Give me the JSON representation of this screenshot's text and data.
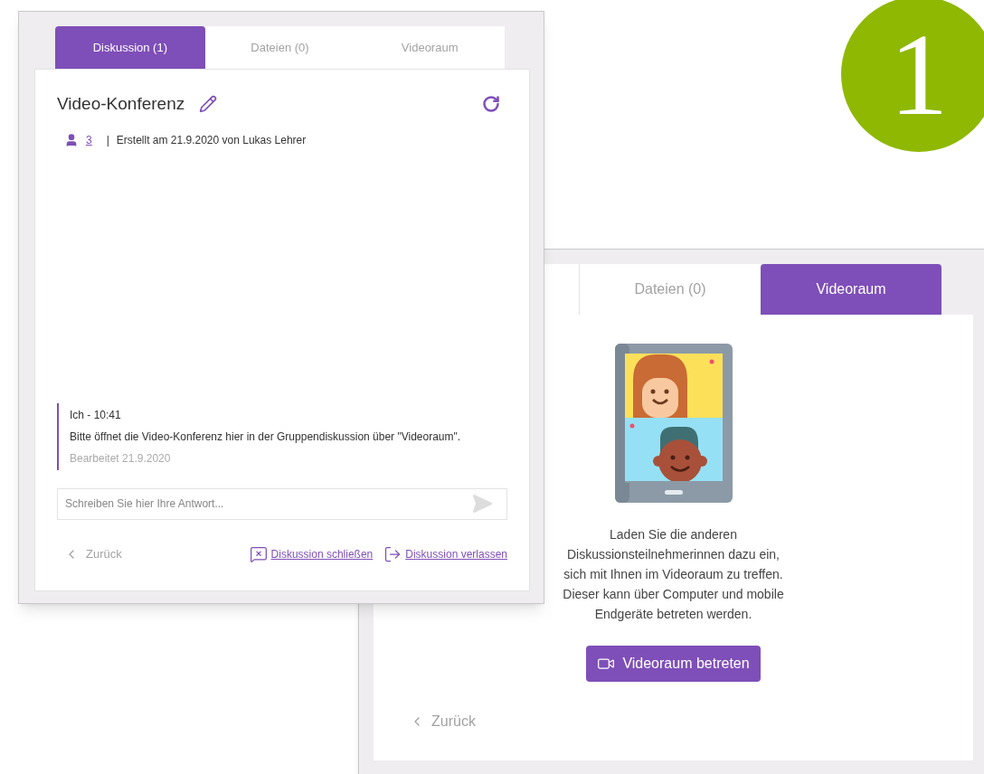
{
  "badge": "1",
  "discussion_window": {
    "tabs": [
      {
        "label": "Diskussion (1)",
        "selected": true
      },
      {
        "label": "Dateien (0)",
        "selected": false
      },
      {
        "label": "Videoraum",
        "selected": false
      }
    ],
    "title": "Video-Konferenz",
    "participants": "3",
    "separator": "|",
    "created": "Erstellt am 21.9.2020 von Lukas Lehrer",
    "message": {
      "header": "Ich - 10:41",
      "text": "Bitte öffnet die Video-Konferenz hier in der Gruppendiskussion über \"Videoraum\".",
      "edited": "Bearbeitet 21.9.2020"
    },
    "reply": {
      "placeholder": "Schreiben Sie hier Ihre Antwort..."
    },
    "back": "Zurück",
    "actions": [
      {
        "kind": "close",
        "label": "Diskussion schließen"
      },
      {
        "kind": "leave",
        "label": "Diskussion verlassen"
      }
    ]
  },
  "videoroom_window": {
    "tabs": [
      {
        "label": "Dateien (0)",
        "selected": false
      },
      {
        "label": "Videoraum",
        "selected": true
      }
    ],
    "text": "Laden Sie die anderen Diskussionsteilnehmerinnen dazu ein, sich mit Ihnen im Videoraum zu treffen. Dieser kann über Computer und mobile Endgeräte betreten werden.",
    "button": "Videoraum betreten",
    "back": "Zurück"
  }
}
